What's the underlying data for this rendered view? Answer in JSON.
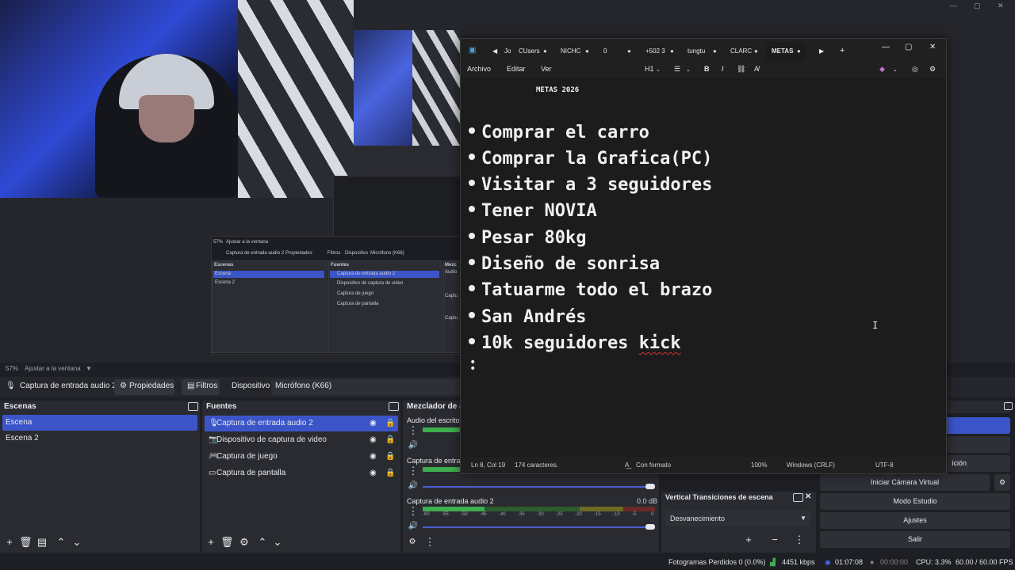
{
  "notepad": {
    "tabs": [
      "Jo",
      "CUsers",
      "NICHC",
      "0",
      "+502 3",
      "tungtu",
      "CLARC",
      "METAS"
    ],
    "active_tab": "METAS",
    "menu": [
      "Archivo",
      "Editar",
      "Ver"
    ],
    "heading_select": "H1",
    "title_line": "METAS 2026",
    "goals": [
      "Comprar el carro",
      "Comprar la Grafica(PC)",
      "Visitar a 3 seguidores",
      "Tener NOVIA",
      "Pesar 80kg",
      "Diseño de sonrisa",
      "Tatuarme todo el brazo",
      "San Andrés",
      "10k seguidores"
    ],
    "last_goal_word": "kick",
    "status": {
      "position": "Ln 8, Col 19",
      "chars": "174 caracteres.",
      "format": "Con formato",
      "zoom": "100%",
      "eol": "Windows (CRLF)",
      "encoding": "UTF-8"
    }
  },
  "obs": {
    "zoom": "57%",
    "fit_label": "Ajustar a la ventana",
    "source_selected": "Captura de entrada audio 2",
    "properties": "Propiedades",
    "filters": "Filtros",
    "device_label": "Dispositivo",
    "device_value": "Micrófono (K66)",
    "scenes_title": "Escenas",
    "scenes": [
      "Escena",
      "Escena 2"
    ],
    "sources_title": "Fuentes",
    "sources": [
      "Captura de entrada audio 2",
      "Dispositivo de captura de video",
      "Captura de juego",
      "Captura de pantalla"
    ],
    "mixer_title": "Mezclador de a",
    "mixer_channels": [
      "Audio del escrito",
      "Captura de entra",
      "Captura de entrada audio 2"
    ],
    "mixer_db": "0.0 dB",
    "scale": [
      "-60",
      "-55",
      "-50",
      "-45",
      "-40",
      "-35",
      "-30",
      "-25",
      "-20",
      "-15",
      "-10",
      "-5",
      "0"
    ],
    "transitions_title": "Vertical Transiciones de escena",
    "transition_value": "Desvanecimiento",
    "controls": [
      "n",
      "",
      "ición",
      "Iniciar Cámara Virtual",
      "Modo Estudio",
      "Ajustes",
      "Salir"
    ],
    "status": {
      "dropped": "Fotogramas Perdidos 0 (0.0%)",
      "bitrate": "4451 kbps",
      "time_live": "01:07:08",
      "time_rec": "00:00:00",
      "cpu": "CPU: 3.3%",
      "fps": "60.00 / 60.00 FPS"
    },
    "nested": {
      "zoom": "57%",
      "fit": "Ajustar a la ventana",
      "source": "Captura de entrada audio 2",
      "props": "Propiedades",
      "filters": "Filtros",
      "device": "Dispositivo",
      "device_value": "Micrófono (K66)",
      "scenes": "Escenas",
      "scene1": "Escena",
      "scene2": "Escena 2",
      "sources": "Fuentes",
      "src1": "Captura de entrada audio 2",
      "src2": "Dispositivo de captura de video",
      "src3": "Captura de juego",
      "src4": "Captura de pantalla",
      "mixer": "Mezc",
      "m1": "Audio",
      "m2": "Captu",
      "m3": "Captu"
    }
  },
  "colors": {
    "accent": "#3b55c8",
    "bg": "#1e1f24",
    "notepad_bg": "#1c1c1c"
  }
}
